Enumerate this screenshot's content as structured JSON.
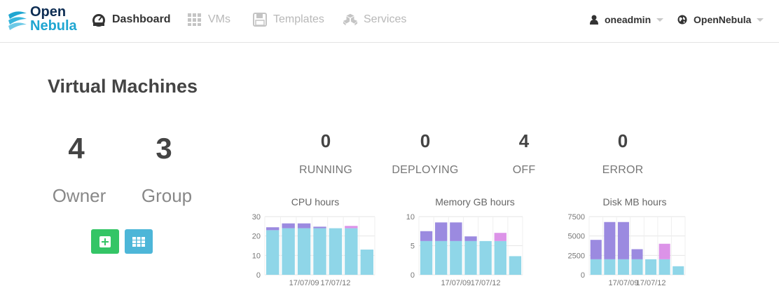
{
  "header": {
    "logo": {
      "line1": "Open",
      "line2": "Nebula"
    },
    "nav": [
      {
        "label": "Dashboard",
        "icon": "dashboard-icon",
        "active": true
      },
      {
        "label": "VMs",
        "icon": "grid-icon",
        "active": false
      },
      {
        "label": "Templates",
        "icon": "floppy-icon",
        "active": false
      },
      {
        "label": "Services",
        "icon": "cubes-icon",
        "active": false
      }
    ],
    "user": {
      "label": "oneadmin",
      "icon": "user-icon"
    },
    "zone": {
      "label": "OpenNebula",
      "icon": "globe-icon"
    }
  },
  "main": {
    "title": "Virtual Machines",
    "owner": {
      "value": "4",
      "label": "Owner"
    },
    "group": {
      "value": "3",
      "label": "Group"
    },
    "states": [
      {
        "value": "0",
        "label": "RUNNING"
      },
      {
        "value": "0",
        "label": "DEPLOYING"
      },
      {
        "value": "4",
        "label": "OFF"
      },
      {
        "value": "0",
        "label": "ERROR"
      }
    ]
  },
  "colors": {
    "base": "#8fd6e8",
    "purple": "#9b8ae0",
    "pink": "#dc93e8",
    "add_button": "#34c566",
    "list_button": "#4db6d8"
  },
  "chart_data": [
    {
      "type": "bar",
      "title": "CPU hours",
      "ylim": [
        0,
        30
      ],
      "yticks": [
        "0",
        "10",
        "20",
        "30"
      ],
      "xtick_labels": [
        "17/07/09",
        "17/07/12"
      ],
      "series": [
        {
          "color": "#8fd6e8",
          "values": [
            23,
            24,
            24,
            24,
            24,
            24,
            13
          ]
        },
        {
          "color": "#9b8ae0",
          "values": [
            1.5,
            2.5,
            2.5,
            0.8,
            0,
            0,
            0
          ]
        },
        {
          "color": "#dc93e8",
          "values": [
            0,
            0,
            0,
            0,
            0,
            1.2,
            0
          ]
        }
      ]
    },
    {
      "type": "bar",
      "title": "Memory GB hours",
      "ylim": [
        0,
        10
      ],
      "yticks": [
        "0",
        "5",
        "10"
      ],
      "xtick_labels": [
        "17/07/09",
        "17/07/12"
      ],
      "series": [
        {
          "color": "#8fd6e8",
          "values": [
            5.8,
            5.8,
            5.8,
            5.8,
            5.8,
            5.8,
            3.2
          ]
        },
        {
          "color": "#9b8ae0",
          "values": [
            1.7,
            3.2,
            3.2,
            0.8,
            0,
            0,
            0
          ]
        },
        {
          "color": "#dc93e8",
          "values": [
            0,
            0,
            0,
            0,
            0,
            1.4,
            0
          ]
        }
      ]
    },
    {
      "type": "bar",
      "title": "Disk MB hours",
      "ylim": [
        0,
        7500
      ],
      "yticks": [
        "0",
        "2500",
        "5000",
        "7500"
      ],
      "xtick_labels": [
        "17/07/09",
        "17/07/12"
      ],
      "series": [
        {
          "color": "#8fd6e8",
          "values": [
            2000,
            2000,
            2000,
            2000,
            2000,
            2000,
            1100
          ]
        },
        {
          "color": "#9b8ae0",
          "values": [
            2500,
            4800,
            4800,
            1300,
            0,
            0,
            0
          ]
        },
        {
          "color": "#dc93e8",
          "values": [
            0,
            0,
            0,
            0,
            0,
            2000,
            0
          ]
        }
      ]
    }
  ]
}
